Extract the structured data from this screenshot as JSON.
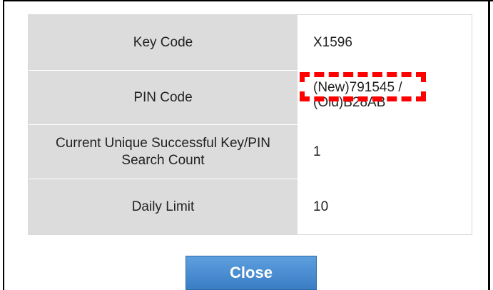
{
  "table": {
    "rows": [
      {
        "label": "Key Code",
        "value": "X1596"
      },
      {
        "label": "PIN Code",
        "value_new": "(New)791545 /",
        "value_old": "(Old)B28AB"
      },
      {
        "label": "Current Unique Successful Key/PIN Search Count",
        "value": "1"
      },
      {
        "label": "Daily Limit",
        "value": "10"
      }
    ]
  },
  "buttons": {
    "close_label": "Close"
  },
  "colors": {
    "label_background": "#dcdcdc",
    "highlight": "#ff0000",
    "button": "#4a8fd3"
  }
}
